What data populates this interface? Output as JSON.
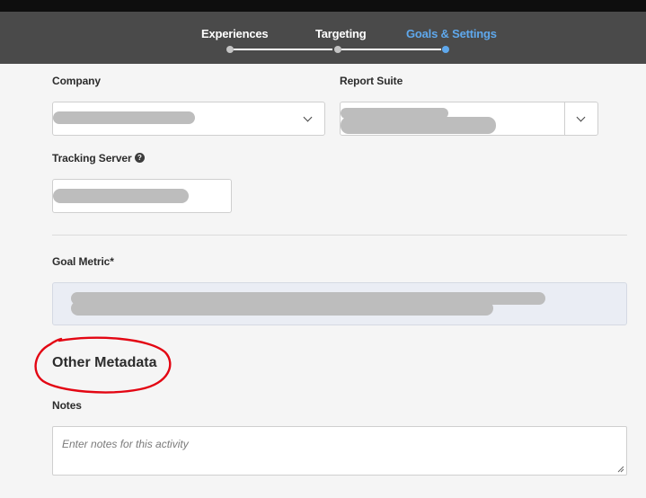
{
  "steps": [
    {
      "label": "Experiences",
      "state": "complete"
    },
    {
      "label": "Targeting",
      "state": "complete"
    },
    {
      "label": "Goals & Settings",
      "state": "active"
    }
  ],
  "colors": {
    "active_step": "#5fa8ec",
    "annotation": "#e30613",
    "stepbar_bg": "#4a4a4a"
  },
  "fields": {
    "company_label": "Company",
    "report_suite_label": "Report Suite",
    "tracking_server_label": "Tracking Server",
    "goal_metric_label": "Goal Metric*"
  },
  "section": {
    "other_metadata_title": "Other Metadata"
  },
  "notes": {
    "label": "Notes",
    "placeholder": "Enter notes for this activity"
  },
  "icons": {
    "help": "question-circle-icon",
    "dropdown": "chevron-down-icon"
  }
}
